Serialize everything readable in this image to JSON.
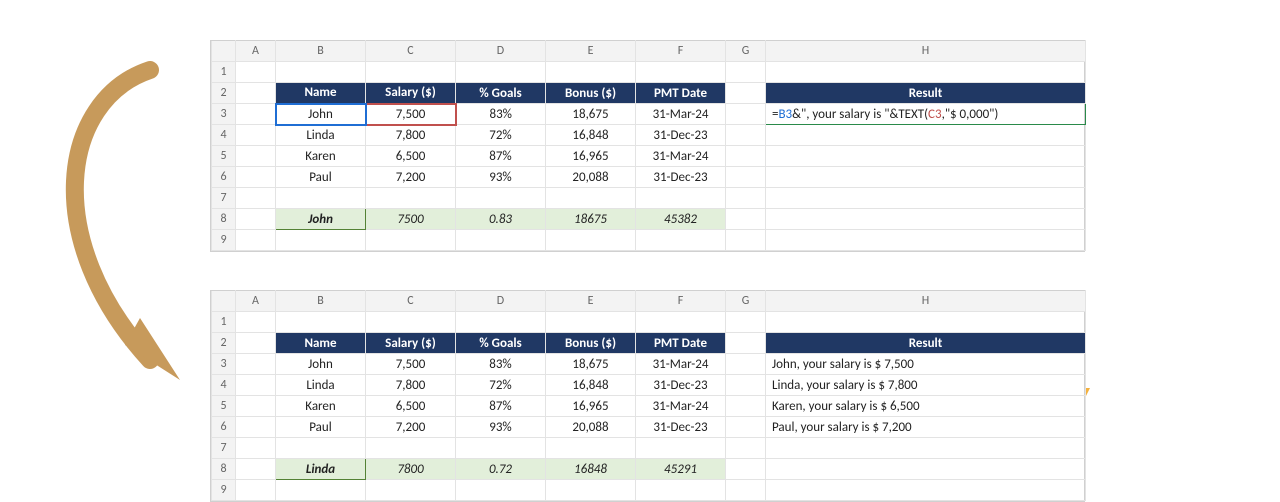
{
  "columns": [
    "A",
    "B",
    "C",
    "D",
    "E",
    "F",
    "G",
    "H"
  ],
  "rows": [
    "1",
    "2",
    "3",
    "4",
    "5",
    "6",
    "7",
    "8",
    "9"
  ],
  "headers": {
    "name": "Name",
    "salary": "Salary ($)",
    "goals": "% Goals",
    "bonus": "Bonus ($)",
    "pmt": "PMT Date",
    "result": "Result"
  },
  "data": [
    {
      "name": "John",
      "salary": "7,500",
      "goals": "83%",
      "bonus": "18,675",
      "pmt": "31-Mar-24"
    },
    {
      "name": "Linda",
      "salary": "7,800",
      "goals": "72%",
      "bonus": "16,848",
      "pmt": "31-Dec-23"
    },
    {
      "name": "Karen",
      "salary": "6,500",
      "goals": "87%",
      "bonus": "16,965",
      "pmt": "31-Mar-24"
    },
    {
      "name": "Paul",
      "salary": "7,200",
      "goals": "93%",
      "bonus": "20,088",
      "pmt": "31-Dec-23"
    }
  ],
  "top": {
    "formula_parts": {
      "eq": "=",
      "ref_b": "B3",
      "mid": "&\", your salary is \"&TEXT(",
      "ref_c": "C3",
      "tail": ",\"$ 0,000\")"
    },
    "summary": {
      "name": "John",
      "salary": "7500",
      "goals": "0.83",
      "bonus": "18675",
      "pmt": "45382"
    }
  },
  "bot": {
    "results": [
      "John, your salary is $ 7,500",
      "Linda, your salary is $ 7,800",
      "Karen, your salary is $ 6,500",
      "Paul, your salary is $ 7,200"
    ],
    "summary": {
      "name": "Linda",
      "salary": "7800",
      "goals": "0.72",
      "bonus": "16848",
      "pmt": "45291"
    }
  },
  "chart_data": {
    "type": "table",
    "columns": [
      "Name",
      "Salary ($)",
      "% Goals",
      "Bonus ($)",
      "PMT Date"
    ],
    "rows": [
      [
        "John",
        7500,
        0.83,
        18675,
        "31-Mar-24"
      ],
      [
        "Linda",
        7800,
        0.72,
        16848,
        "31-Dec-23"
      ],
      [
        "Karen",
        6500,
        0.87,
        16965,
        "31-Mar-24"
      ],
      [
        "Paul",
        7200,
        0.93,
        20088,
        "31-Dec-23"
      ]
    ],
    "formula": "=B3&\", your salary is \"&TEXT(C3,\"$ 0,000\")",
    "results": [
      "John, your salary is $ 7,500",
      "Linda, your salary is $ 7,800",
      "Karen, your salary is $ 6,500",
      "Paul, your salary is $ 7,200"
    ]
  }
}
